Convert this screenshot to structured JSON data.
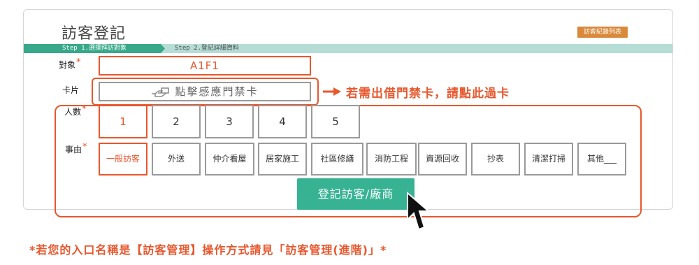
{
  "header": {
    "title": "訪客登記",
    "list_button": "訪客紀錄列表"
  },
  "steps": [
    {
      "label": "Step 1.選擇拜訪對象"
    },
    {
      "label": "Step 2.登記詳細資料"
    }
  ],
  "form": {
    "target_label": "對象",
    "target_value": "A1F1",
    "card_label": "卡片",
    "card_button": "點擊感應門禁卡",
    "card_note": "若需出借門禁卡，請點此過卡",
    "count_label": "人數",
    "count_options": [
      "1",
      "2",
      "3",
      "4",
      "5"
    ],
    "count_selected": "1",
    "reason_label": "事由",
    "reason_options": [
      "一般訪客",
      "外送",
      "仲介看屋",
      "居家施工",
      "社區修繕",
      "消防工程",
      "資源回收",
      "抄表",
      "清潔打掃",
      "其他___"
    ],
    "reason_selected": "一般訪客",
    "required_mark": "*",
    "submit": "登記訪客/廠商"
  },
  "footer_note": "*若您的入口名稱是【訪客管理】操作方式請見「訪客管理(進階)」*",
  "colors": {
    "accent": "#e8572d",
    "brand_green": "#37b394",
    "step_active": "#37a889",
    "step_bar": "#b5ddd5",
    "list_button": "#d9893a"
  },
  "icons": {
    "card": "hand-card-icon",
    "arrow": "arrow-right-icon",
    "cursor": "mouse-pointer-icon"
  }
}
